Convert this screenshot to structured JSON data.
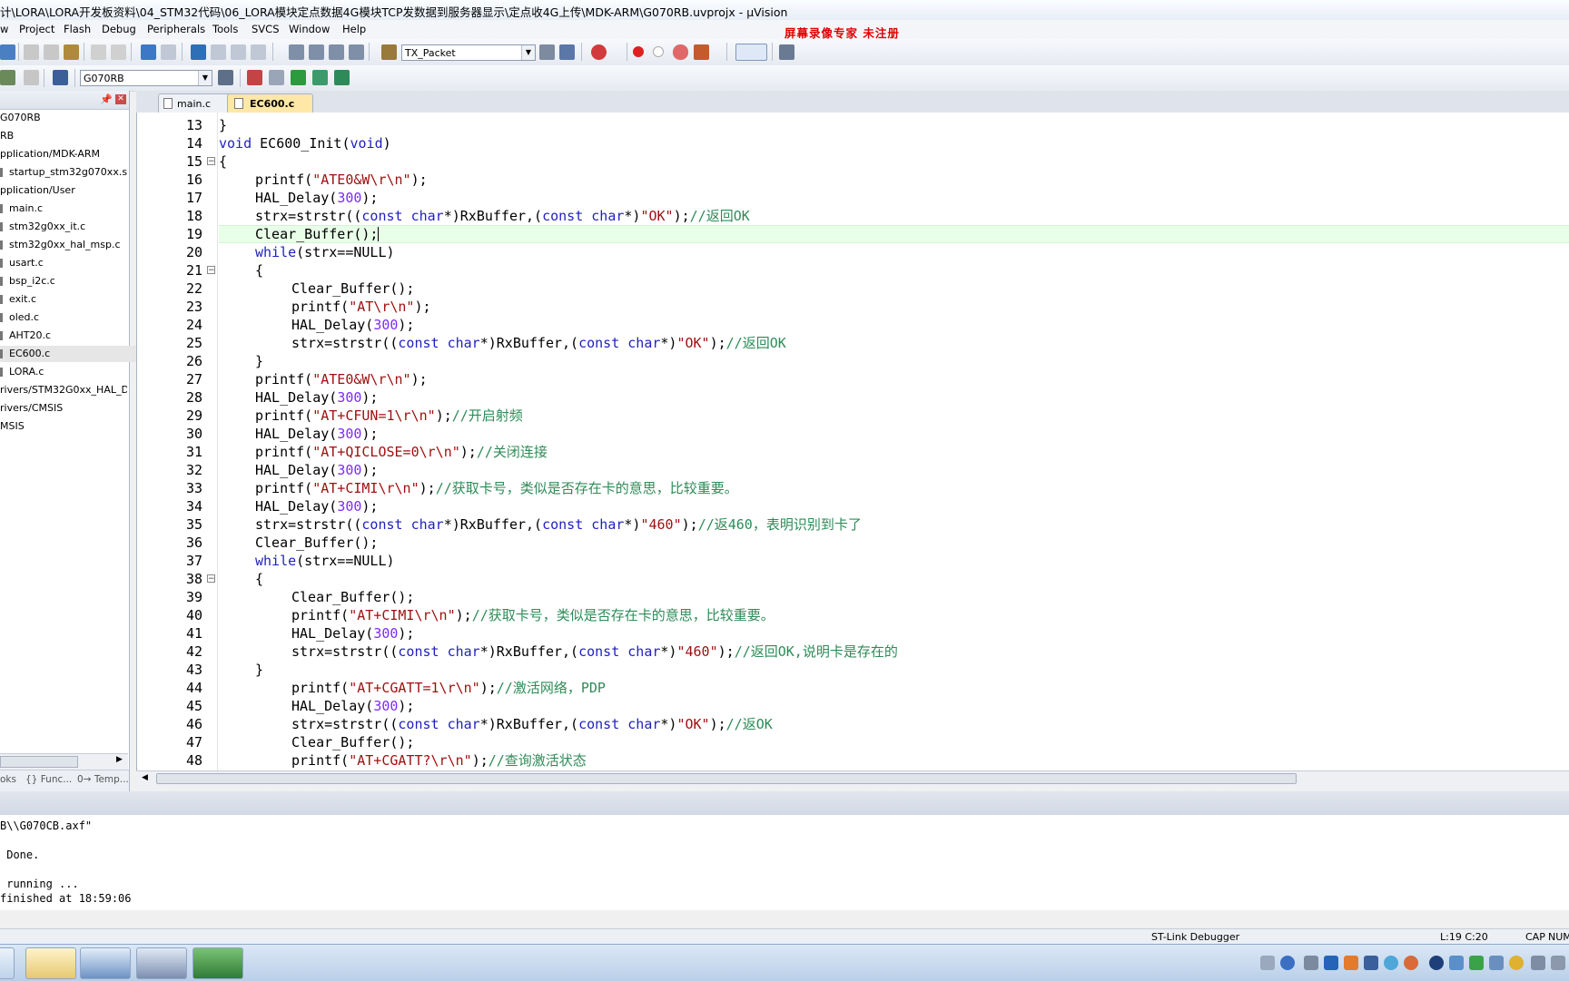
{
  "window": {
    "title": "计\\LORA\\LORA开发板资料\\04_STM32代码\\06_LORA模块定点数据4G模块TCP发数据到服务器显示\\定点收4G上传\\MDK-ARM\\G070RB.uvprojx - µVision",
    "watermark": "屏幕录像专家  未注册"
  },
  "menu": [
    "w",
    "Project",
    "Flash",
    "Debug",
    "Peripherals",
    "Tools",
    "SVCS",
    "Window",
    "Help"
  ],
  "toolbar": {
    "target_combo": "TX_Packet",
    "project_combo": "G070RB"
  },
  "project_tree": [
    {
      "label": "G070RB",
      "indent": 0
    },
    {
      "label": "RB",
      "indent": 0
    },
    {
      "label": "pplication/MDK-ARM",
      "indent": 0
    },
    {
      "label": "startup_stm32g070xx.s",
      "indent": 1
    },
    {
      "label": "pplication/User",
      "indent": 0
    },
    {
      "label": "main.c",
      "indent": 1
    },
    {
      "label": "stm32g0xx_it.c",
      "indent": 1
    },
    {
      "label": "stm32g0xx_hal_msp.c",
      "indent": 1
    },
    {
      "label": "usart.c",
      "indent": 1
    },
    {
      "label": "bsp_i2c.c",
      "indent": 1
    },
    {
      "label": "exit.c",
      "indent": 1
    },
    {
      "label": "oled.c",
      "indent": 1
    },
    {
      "label": "AHT20.c",
      "indent": 1
    },
    {
      "label": "EC600.c",
      "indent": 1
    },
    {
      "label": "LORA.c",
      "indent": 1
    },
    {
      "label": "rivers/STM32G0xx_HAL_Driv",
      "indent": 0
    },
    {
      "label": "rivers/CMSIS",
      "indent": 0
    },
    {
      "label": "MSIS",
      "indent": 0
    }
  ],
  "panel_tabs": [
    "oks",
    "{} Func...",
    "0→ Temp..."
  ],
  "editor_tabs": [
    {
      "label": "main.c",
      "active": false
    },
    {
      "label": "EC600.c",
      "active": true
    }
  ],
  "code_lines": [
    {
      "n": "13",
      "indent": 0,
      "parts": [
        [
          "p",
          "}"
        ]
      ]
    },
    {
      "n": "14",
      "indent": 0,
      "parts": [
        [
          "kw",
          "void"
        ],
        [
          "p",
          " EC600_Init("
        ],
        [
          "kw",
          "void"
        ],
        [
          "p",
          ")"
        ]
      ]
    },
    {
      "n": "15",
      "indent": 0,
      "parts": [
        [
          "p",
          "{"
        ]
      ]
    },
    {
      "n": "16",
      "indent": 1,
      "parts": [
        [
          "p",
          "printf("
        ],
        [
          "str",
          "\"ATE0&W\\r\\n\""
        ],
        [
          "p",
          ");"
        ]
      ]
    },
    {
      "n": "17",
      "indent": 1,
      "parts": [
        [
          "p",
          "HAL_Delay("
        ],
        [
          "num",
          "300"
        ],
        [
          "p",
          ");"
        ]
      ]
    },
    {
      "n": "18",
      "indent": 1,
      "parts": [
        [
          "p",
          "strx=strstr(("
        ],
        [
          "kw",
          "const char"
        ],
        [
          "p",
          "*)RxBuffer,("
        ],
        [
          "kw",
          "const char"
        ],
        [
          "p",
          "*)"
        ],
        [
          "str",
          "\"OK\""
        ],
        [
          "p",
          ");"
        ],
        [
          "cm",
          "//返回OK"
        ]
      ]
    },
    {
      "n": "19",
      "indent": 1,
      "parts": [
        [
          "p",
          "Clear_Buffer();"
        ]
      ]
    },
    {
      "n": "20",
      "indent": 1,
      "parts": [
        [
          "kw",
          "while"
        ],
        [
          "p",
          "(strx==NULL)"
        ]
      ]
    },
    {
      "n": "21",
      "indent": 1,
      "parts": [
        [
          "p",
          "{"
        ]
      ]
    },
    {
      "n": "22",
      "indent": 2,
      "parts": [
        [
          "p",
          "Clear_Buffer();"
        ]
      ]
    },
    {
      "n": "23",
      "indent": 2,
      "parts": [
        [
          "p",
          "printf("
        ],
        [
          "str",
          "\"AT\\r\\n\""
        ],
        [
          "p",
          ");"
        ]
      ]
    },
    {
      "n": "24",
      "indent": 2,
      "parts": [
        [
          "p",
          "HAL_Delay("
        ],
        [
          "num",
          "300"
        ],
        [
          "p",
          ");"
        ]
      ]
    },
    {
      "n": "25",
      "indent": 2,
      "parts": [
        [
          "p",
          "strx=strstr(("
        ],
        [
          "kw",
          "const char"
        ],
        [
          "p",
          "*)RxBuffer,("
        ],
        [
          "kw",
          "const char"
        ],
        [
          "p",
          "*)"
        ],
        [
          "str",
          "\"OK\""
        ],
        [
          "p",
          ");"
        ],
        [
          "cm",
          "//返回OK"
        ]
      ]
    },
    {
      "n": "26",
      "indent": 1,
      "parts": [
        [
          "p",
          "}"
        ]
      ]
    },
    {
      "n": "27",
      "indent": 1,
      "parts": [
        [
          "p",
          "printf("
        ],
        [
          "str",
          "\"ATE0&W\\r\\n\""
        ],
        [
          "p",
          ");"
        ]
      ]
    },
    {
      "n": "28",
      "indent": 1,
      "parts": [
        [
          "p",
          "HAL_Delay("
        ],
        [
          "num",
          "300"
        ],
        [
          "p",
          ");"
        ]
      ]
    },
    {
      "n": "29",
      "indent": 1,
      "parts": [
        [
          "p",
          "printf("
        ],
        [
          "str",
          "\"AT+CFUN=1\\r\\n\""
        ],
        [
          "p",
          ");"
        ],
        [
          "cm",
          "//开启射频"
        ]
      ]
    },
    {
      "n": "30",
      "indent": 1,
      "parts": [
        [
          "p",
          "HAL_Delay("
        ],
        [
          "num",
          "300"
        ],
        [
          "p",
          ");"
        ]
      ]
    },
    {
      "n": "31",
      "indent": 1,
      "parts": [
        [
          "p",
          "printf("
        ],
        [
          "str",
          "\"AT+QICLOSE=0\\r\\n\""
        ],
        [
          "p",
          ");"
        ],
        [
          "cm",
          "//关闭连接"
        ]
      ]
    },
    {
      "n": "32",
      "indent": 1,
      "parts": [
        [
          "p",
          "HAL_Delay("
        ],
        [
          "num",
          "300"
        ],
        [
          "p",
          ");"
        ]
      ]
    },
    {
      "n": "33",
      "indent": 1,
      "parts": [
        [
          "p",
          "printf("
        ],
        [
          "str",
          "\"AT+CIMI\\r\\n\""
        ],
        [
          "p",
          ");"
        ],
        [
          "cm",
          "//获取卡号，类似是否存在卡的意思，比较重要。"
        ]
      ]
    },
    {
      "n": "34",
      "indent": 1,
      "parts": [
        [
          "p",
          "HAL_Delay("
        ],
        [
          "num",
          "300"
        ],
        [
          "p",
          ");"
        ]
      ]
    },
    {
      "n": "35",
      "indent": 1,
      "parts": [
        [
          "p",
          "strx=strstr(("
        ],
        [
          "kw",
          "const char"
        ],
        [
          "p",
          "*)RxBuffer,("
        ],
        [
          "kw",
          "const char"
        ],
        [
          "p",
          "*)"
        ],
        [
          "str",
          "\"460\""
        ],
        [
          "p",
          ");"
        ],
        [
          "cm",
          "//返460，表明识别到卡了"
        ]
      ]
    },
    {
      "n": "36",
      "indent": 1,
      "parts": [
        [
          "p",
          "Clear_Buffer();"
        ]
      ]
    },
    {
      "n": "37",
      "indent": 1,
      "parts": [
        [
          "kw",
          "while"
        ],
        [
          "p",
          "(strx==NULL)"
        ]
      ]
    },
    {
      "n": "38",
      "indent": 1,
      "parts": [
        [
          "p",
          "{"
        ]
      ]
    },
    {
      "n": "39",
      "indent": 2,
      "parts": [
        [
          "p",
          "Clear_Buffer();"
        ]
      ]
    },
    {
      "n": "40",
      "indent": 2,
      "parts": [
        [
          "p",
          "printf("
        ],
        [
          "str",
          "\"AT+CIMI\\r\\n\""
        ],
        [
          "p",
          ");"
        ],
        [
          "cm",
          "//获取卡号，类似是否存在卡的意思，比较重要。"
        ]
      ]
    },
    {
      "n": "41",
      "indent": 2,
      "parts": [
        [
          "p",
          "HAL_Delay("
        ],
        [
          "num",
          "300"
        ],
        [
          "p",
          ");"
        ]
      ]
    },
    {
      "n": "42",
      "indent": 2,
      "parts": [
        [
          "p",
          "strx=strstr(("
        ],
        [
          "kw",
          "const char"
        ],
        [
          "p",
          "*)RxBuffer,("
        ],
        [
          "kw",
          "const char"
        ],
        [
          "p",
          "*)"
        ],
        [
          "str",
          "\"460\""
        ],
        [
          "p",
          ");"
        ],
        [
          "cm",
          "//返回OK,说明卡是存在的"
        ]
      ]
    },
    {
      "n": "43",
      "indent": 1,
      "parts": [
        [
          "p",
          "}"
        ]
      ]
    },
    {
      "n": "44",
      "indent": 2,
      "parts": [
        [
          "p",
          "printf("
        ],
        [
          "str",
          "\"AT+CGATT=1\\r\\n\""
        ],
        [
          "p",
          ");"
        ],
        [
          "cm",
          "//激活网络，PDP"
        ]
      ]
    },
    {
      "n": "45",
      "indent": 2,
      "parts": [
        [
          "p",
          "HAL_Delay("
        ],
        [
          "num",
          "300"
        ],
        [
          "p",
          ");"
        ]
      ]
    },
    {
      "n": "46",
      "indent": 2,
      "parts": [
        [
          "p",
          "strx=strstr(("
        ],
        [
          "kw",
          "const char"
        ],
        [
          "p",
          "*)RxBuffer,("
        ],
        [
          "kw",
          "const char"
        ],
        [
          "p",
          "*)"
        ],
        [
          "str",
          "\"OK\""
        ],
        [
          "p",
          ");"
        ],
        [
          "cm",
          "//返OK"
        ]
      ]
    },
    {
      "n": "47",
      "indent": 2,
      "parts": [
        [
          "p",
          "Clear_Buffer();"
        ]
      ]
    },
    {
      "n": "48",
      "indent": 2,
      "parts": [
        [
          "p",
          "printf("
        ],
        [
          "str",
          "\"AT+CGATT?\\r\\n\""
        ],
        [
          "p",
          ");"
        ],
        [
          "cm",
          "//查询激活状态"
        ]
      ]
    }
  ],
  "build_output": [
    "B\\\\G070CB.axf\"",
    "",
    " Done.",
    "",
    " running ...",
    "finished at 18:59:06"
  ],
  "status": {
    "debugger": "ST-Link Debugger",
    "cursor": "L:19 C:20",
    "cap": "CAP",
    "num": "NUM"
  }
}
